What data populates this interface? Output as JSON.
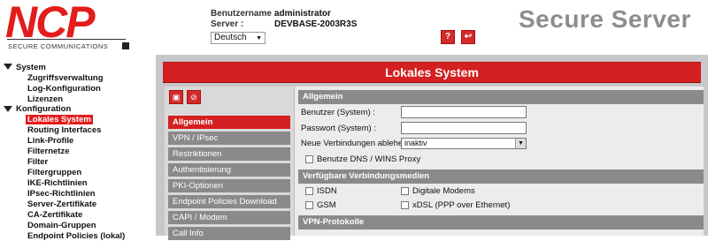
{
  "header": {
    "logo_text": "NCP",
    "logo_tagline": "SECURE COMMUNICATIONS",
    "username_label": "Benutzername :",
    "username_value": "administrator",
    "server_label": "Server :",
    "server_value": "DEVBASE-2003R3S",
    "language": "Deutsch",
    "product_title": "Secure Server",
    "help_icon": "help-icon",
    "logout_icon": "logout-icon"
  },
  "sidebar": {
    "system": {
      "label": "System",
      "items": [
        "Zugriffsverwaltung",
        "Log-Konfiguration",
        "Lizenzen"
      ]
    },
    "konfiguration": {
      "label": "Konfiguration",
      "items": [
        "Lokales System",
        "Routing Interfaces",
        "Link-Profile",
        "Filternetze",
        "Filter",
        "Filtergruppen",
        "IKE-Richtlinien",
        "IPsec-Richtlinien",
        "Server-Zertifikate",
        "CA-Zertifikate",
        "Domain-Gruppen",
        "Endpoint Policies (lokal)"
      ]
    },
    "selected": "Lokales System"
  },
  "main": {
    "title": "Lokales System",
    "toolbar": {
      "save_icon": "save-icon",
      "discard_icon": "discard-icon"
    },
    "subnav": [
      "Allgemein",
      "VPN / IPsec",
      "Restriktionen",
      "Authentisierung",
      "PKI-Optionen",
      "Endpoint Policies Download",
      "CAPI / Modem",
      "Call Info"
    ],
    "active_subnav": "Allgemein",
    "sections": {
      "allgemein": {
        "title": "Allgemein",
        "user_label": "Benutzer (System) :",
        "user_value": "",
        "password_label": "Passwort (System) :",
        "password_value": "",
        "reject_label": "Neue Verbindungen ablehen:",
        "reject_value": "inaktiv",
        "dns_label": "Benutze DNS / WINS Proxy",
        "dns_checked": false
      },
      "medien": {
        "title": "Verfügbare Verbindungsmedien",
        "isdn": "ISDN",
        "gsm": "GSM",
        "modems": "Digitale Modems",
        "xdsl": "xDSL (PPP over Ethernet)"
      },
      "vpn": {
        "title": "VPN-Protokolle"
      }
    }
  },
  "colors": {
    "accent": "#d42020",
    "nav_gray": "#8a8a8a",
    "frame_gray": "#c8c8c8"
  }
}
